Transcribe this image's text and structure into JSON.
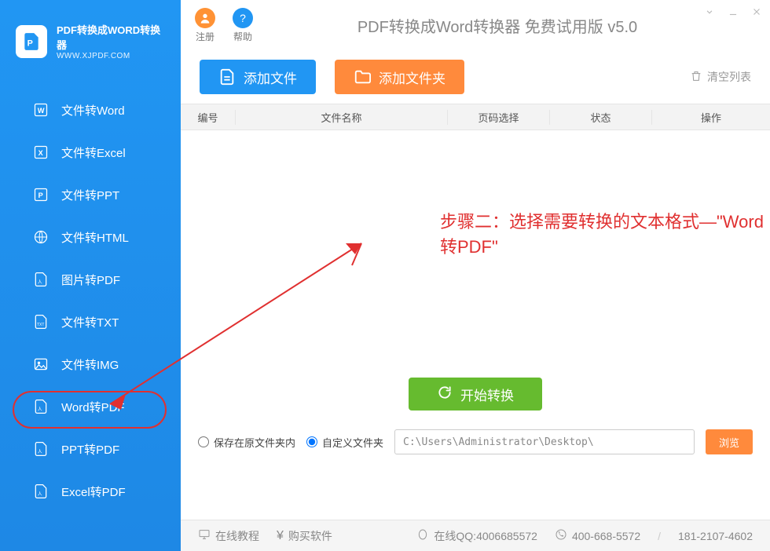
{
  "logo": {
    "title": "PDF转换成WORD转换器",
    "subtitle": "WWW.XJPDF.COM"
  },
  "sidebar": {
    "items": [
      {
        "label": "文件转Word",
        "icon": "word"
      },
      {
        "label": "文件转Excel",
        "icon": "excel"
      },
      {
        "label": "文件转PPT",
        "icon": "ppt"
      },
      {
        "label": "文件转HTML",
        "icon": "html"
      },
      {
        "label": "图片转PDF",
        "icon": "pdf"
      },
      {
        "label": "文件转TXT",
        "icon": "txt"
      },
      {
        "label": "文件转IMG",
        "icon": "img"
      },
      {
        "label": "Word转PDF",
        "icon": "pdf"
      },
      {
        "label": "PPT转PDF",
        "icon": "pdf"
      },
      {
        "label": "Excel转PDF",
        "icon": "pdf"
      }
    ]
  },
  "topbar": {
    "register": "注册",
    "help": "帮助",
    "title": "PDF转换成Word转换器 免费试用版 v5.0"
  },
  "toolbar": {
    "add_file": "添加文件",
    "add_folder": "添加文件夹",
    "clear": "清空列表"
  },
  "table": {
    "col1": "编号",
    "col2": "文件名称",
    "col3": "页码选择",
    "col4": "状态",
    "col5": "操作"
  },
  "convert": {
    "start": "开始转换"
  },
  "save": {
    "opt_original": "保存在原文件夹内",
    "opt_custom": "自定义文件夹",
    "path": "C:\\Users\\Administrator\\Desktop\\",
    "browse": "浏览"
  },
  "footer": {
    "tutorial": "在线教程",
    "buy": "购买软件",
    "qq_label": "在线QQ:4006685572",
    "phone1": "400-668-5572",
    "phone2": "181-2107-4602"
  },
  "annotation": "步骤二：选择需要转换的文本格式—\"Word转PDF\"",
  "icons": {
    "yen": "¥",
    "qq": "QQ"
  }
}
